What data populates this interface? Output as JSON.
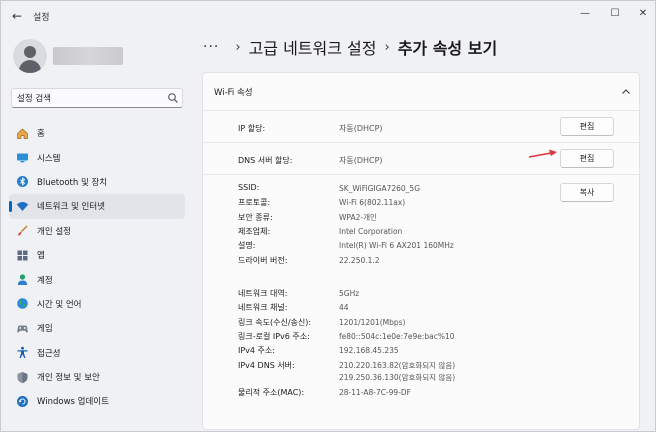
{
  "window": {
    "app_title": "설정",
    "back_glyph": "←",
    "min_glyph": "—",
    "max_glyph": "☐",
    "close_glyph": "✕"
  },
  "sidebar": {
    "search_placeholder": "설정 검색",
    "search_value": "설정 검색",
    "items": [
      {
        "label": "홈",
        "icon": "home-icon"
      },
      {
        "label": "시스템",
        "icon": "system-icon"
      },
      {
        "label": "Bluetooth 및 장치",
        "icon": "bluetooth-icon"
      },
      {
        "label": "네트워크 및 인터넷",
        "icon": "wifi-icon",
        "selected": true
      },
      {
        "label": "개인 설정",
        "icon": "brush-icon"
      },
      {
        "label": "앱",
        "icon": "apps-icon"
      },
      {
        "label": "계정",
        "icon": "account-icon"
      },
      {
        "label": "시간 및 언어",
        "icon": "globe-icon"
      },
      {
        "label": "게임",
        "icon": "gamepad-icon"
      },
      {
        "label": "접근성",
        "icon": "accessibility-icon"
      },
      {
        "label": "개인 정보 및 보안",
        "icon": "shield-icon"
      },
      {
        "label": "Windows 업데이트",
        "icon": "update-icon"
      }
    ]
  },
  "header": {
    "more": "···",
    "sep": "›",
    "crumb_parent": "고급 네트워크 설정",
    "crumb_current": "추가 속성 보기"
  },
  "card": {
    "title": "Wi-Fi 속성",
    "ip": {
      "label": "IP 할당:",
      "value": "자동(DHCP)",
      "button": "편집"
    },
    "dns": {
      "label": "DNS 서버 할당:",
      "value": "자동(DHCP)",
      "button": "편집"
    },
    "copy_button": "복사",
    "properties": [
      {
        "label": "SSID:",
        "value": "SK_WiFiGIGA7260_5G"
      },
      {
        "label": "프로토콜:",
        "value": "Wi-Fi 6(802.11ax)"
      },
      {
        "label": "보안 종류:",
        "value": "WPA2-개인"
      },
      {
        "label": "제조업체:",
        "value": "Intel Corporation"
      },
      {
        "label": "설명:",
        "value": "Intel(R) Wi-Fi 6 AX201 160MHz"
      },
      {
        "label": "드라이버 버전:",
        "value": "22.250.1.2"
      },
      {
        "label": "네트워크 대역:",
        "value": "5GHz"
      },
      {
        "label": "네트워크 채널:",
        "value": "44"
      },
      {
        "label": "링크 속도(수신/송신):",
        "value": "1201/1201(Mbps)"
      },
      {
        "label": "링크-로컬 IPv6 주소:",
        "value": "fe80::504c:1e0e:7e9e:bac%10"
      },
      {
        "label": "IPv4 주소:",
        "value": "192.168.45.235"
      },
      {
        "label": "IPv4 DNS 서버:",
        "value": "210.220.163.82(암호화되지 않음)",
        "value2": "219.250.36.130(암호화되지 않음)"
      },
      {
        "label": "물리적 주소(MAC):",
        "value": "28-11-A8-7C-99-DF"
      }
    ]
  },
  "colors": {
    "accent": "#0067c0",
    "annotation_arrow": "#e0353a"
  }
}
